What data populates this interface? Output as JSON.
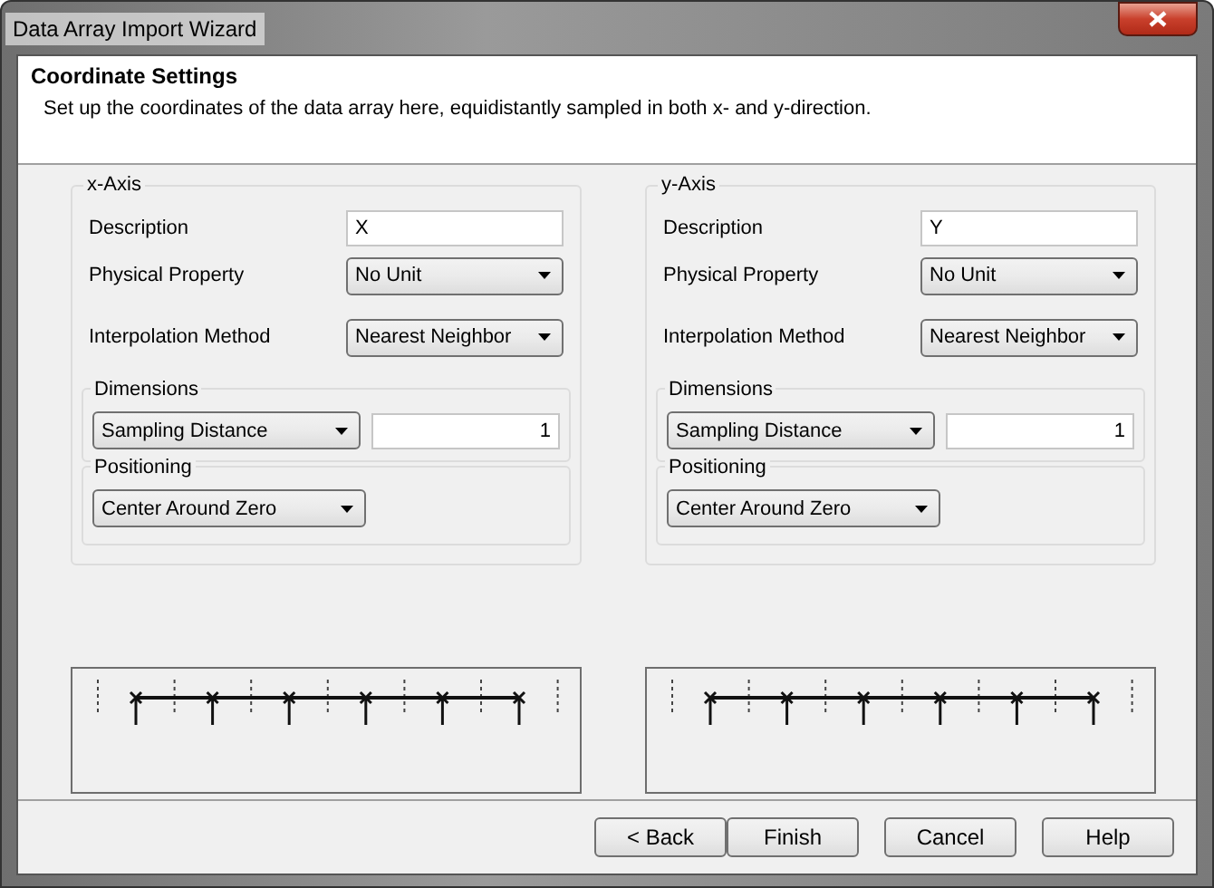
{
  "window": {
    "title": "Data Array Import Wizard"
  },
  "header": {
    "title": "Coordinate Settings",
    "description": "Set up the coordinates of the data array here, equidistantly sampled in both x- and y-direction."
  },
  "axes": [
    {
      "title": "x-Axis",
      "description": {
        "label": "Description",
        "value": "X"
      },
      "physical_property": {
        "label": "Physical Property",
        "value": "No Unit"
      },
      "interpolation": {
        "label": "Interpolation Method",
        "value": "Nearest Neighbor"
      },
      "dimensions": {
        "title": "Dimensions",
        "mode": "Sampling Distance",
        "value": "1"
      },
      "positioning": {
        "title": "Positioning",
        "mode": "Center Around Zero"
      }
    },
    {
      "title": "y-Axis",
      "description": {
        "label": "Description",
        "value": "Y"
      },
      "physical_property": {
        "label": "Physical Property",
        "value": "No Unit"
      },
      "interpolation": {
        "label": "Interpolation Method",
        "value": "Nearest Neighbor"
      },
      "dimensions": {
        "title": "Dimensions",
        "mode": "Sampling Distance",
        "value": "1"
      },
      "positioning": {
        "title": "Positioning",
        "mode": "Center Around Zero"
      }
    }
  ],
  "buttons": [
    "< Back",
    "Finish",
    "Cancel",
    "Help"
  ]
}
